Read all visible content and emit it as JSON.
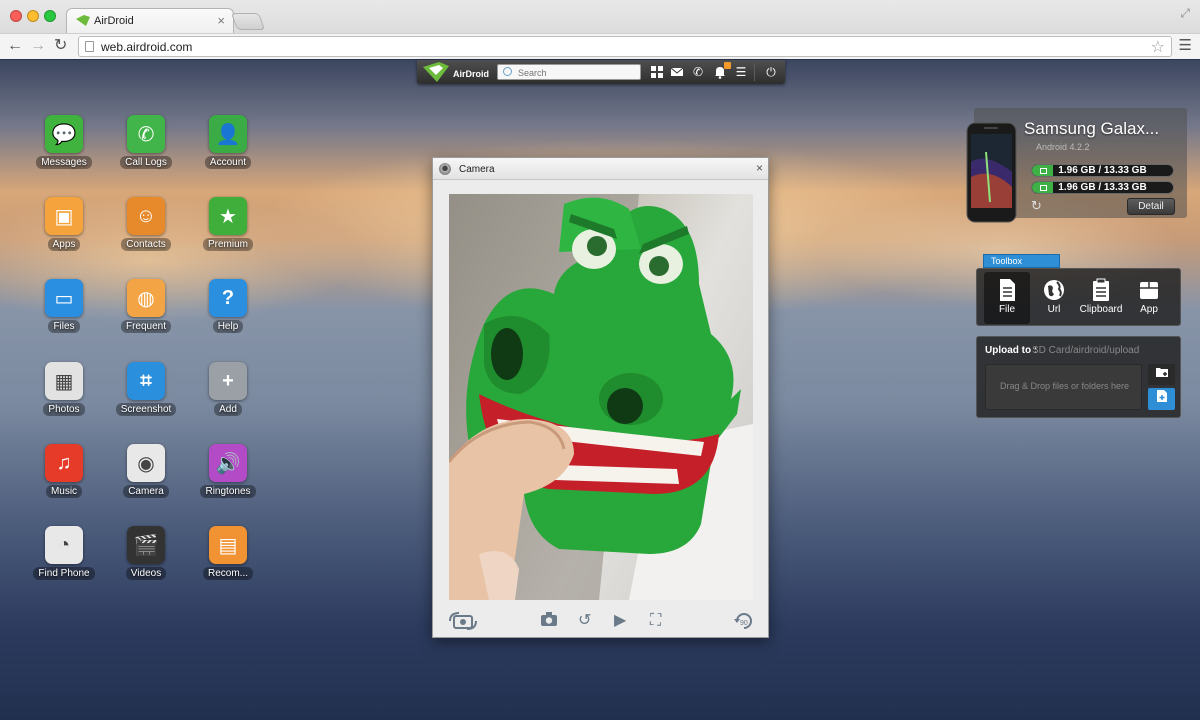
{
  "browser": {
    "tab_title": "AirDroid",
    "tab_close": "×",
    "url": "web.airdroid.com",
    "icons": {
      "back": "back-arrow-icon",
      "forward": "forward-arrow-icon",
      "reload": "reload-icon",
      "star": "star-icon",
      "menu": "hamburger-menu-icon",
      "fullscreen": "fullscreen-icon"
    }
  },
  "toolbar": {
    "logo_text": "AirDroid",
    "search_placeholder": "Search",
    "icons": [
      "apps-grid-icon",
      "messages-icon",
      "phone-icon",
      "notification-bell-icon",
      "list-menu-icon",
      "power-icon"
    ],
    "notification_badge_color": "#f39a2b"
  },
  "apps": [
    {
      "label": "Messages",
      "icon": "messages-icon",
      "color": "#3fb33d"
    },
    {
      "label": "Call Logs",
      "icon": "call-logs-icon",
      "color": "#41b54a"
    },
    {
      "label": "Account",
      "icon": "account-icon",
      "color": "#3aab45"
    },
    {
      "label": "Apps",
      "icon": "apps-icon",
      "color": "#f4a33d"
    },
    {
      "label": "Contacts",
      "icon": "contacts-icon",
      "color": "#e78a2b"
    },
    {
      "label": "Premium",
      "icon": "premium-star-icon",
      "color": "#3fae3a"
    },
    {
      "label": "Files",
      "icon": "files-folder-icon",
      "color": "#2a8fe0"
    },
    {
      "label": "Frequent",
      "icon": "frequent-icon",
      "color": "#f3a545"
    },
    {
      "label": "Help",
      "icon": "help-icon",
      "color": "#2b8fe0"
    },
    {
      "label": "Photos",
      "icon": "photos-icon",
      "color": "#e2e2e2"
    },
    {
      "label": "Screenshot",
      "icon": "screenshot-crop-icon",
      "color": "#2a8fdc"
    },
    {
      "label": "Add",
      "icon": "add-plus-icon",
      "color": "#9aa0a6"
    },
    {
      "label": "Music",
      "icon": "music-note-icon",
      "color": "#e73b2a"
    },
    {
      "label": "Camera",
      "icon": "camera-icon",
      "color": "#e8e8e8"
    },
    {
      "label": "Ringtones",
      "icon": "ringtones-speaker-icon",
      "color": "#b44bc6"
    },
    {
      "label": "Find Phone",
      "icon": "find-phone-radar-icon",
      "color": "#e8e8e8"
    },
    {
      "label": "Videos",
      "icon": "videos-clapper-icon",
      "color": "#333333"
    },
    {
      "label": "Recom...",
      "icon": "recommend-icon",
      "color": "#f19233"
    }
  ],
  "camera_window": {
    "title": "Camera",
    "close": "×",
    "controls": [
      "switch-camera-icon",
      "snapshot-camera-icon",
      "rotate-icon",
      "play-icon",
      "fullscreen-icon",
      "rotate-90-icon"
    ],
    "rotate90_label": "90"
  },
  "device": {
    "name": "Samsung Galax...",
    "os": "Android 4.2.2",
    "storage": [
      {
        "text": "1.96 GB / 13.33 GB",
        "fraction": 0.147
      },
      {
        "text": "1.96 GB / 13.33 GB",
        "fraction": 0.147
      }
    ],
    "detail_label": "Detail",
    "storage_color": "#3fb045"
  },
  "toolbox": {
    "tab_label": "Toolbox",
    "tools": [
      {
        "label": "File",
        "icon": "file-document-icon"
      },
      {
        "label": "Url",
        "icon": "globe-url-icon"
      },
      {
        "label": "Clipboard",
        "icon": "clipboard-icon"
      },
      {
        "label": "App",
        "icon": "app-box-icon"
      }
    ],
    "accent": "#2e8fd6"
  },
  "upload": {
    "label": "Upload to :",
    "path": "SD Card/airdroid/upload",
    "drop_text": "Drag & Drop files or folders here"
  }
}
